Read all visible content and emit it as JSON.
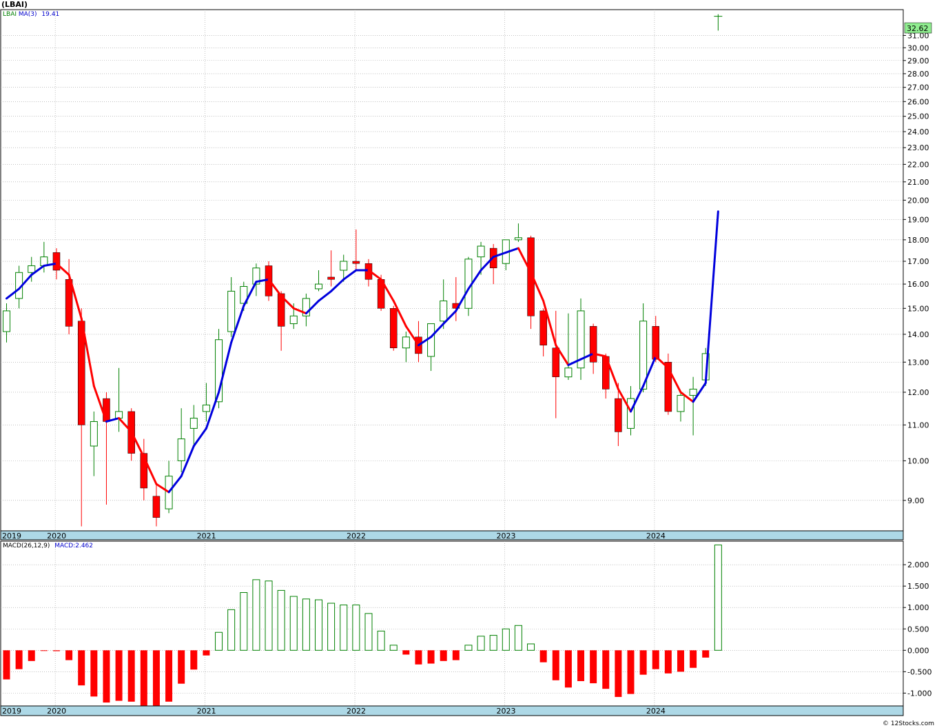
{
  "title": "(LBAI)",
  "legend": {
    "ticker": "LBAI",
    "ma_label": "MA(3)",
    "ma_value": "19.41",
    "macd_label": "MACD(26,12,9)",
    "macd_value": "MACD:2.462"
  },
  "last_price_badge": "32.62",
  "credit": "© 12Stocks.com",
  "colors": {
    "up": "#008000",
    "down": "#ff0000",
    "ma_up": "#0000dd",
    "ma_down": "#ff0000",
    "axis_band": "#add8e6",
    "grid": "#a9a9a9",
    "badge": "#90ee90"
  },
  "chart_data": [
    {
      "type": "candlestick",
      "title": "(LBAI)",
      "yscale": "log",
      "ylim": [
        8.3,
        33.2
      ],
      "y_ticks": [
        "9.00",
        "10.00",
        "11.00",
        "12.00",
        "13.00",
        "14.00",
        "15.00",
        "16.00",
        "17.00",
        "18.00",
        "19.00",
        "20.00",
        "21.00",
        "22.00",
        "23.00",
        "24.00",
        "25.00",
        "26.00",
        "27.00",
        "28.00",
        "29.00",
        "30.00",
        "31.00"
      ],
      "x_ticks": [
        "2019",
        "2020",
        "2021",
        "2022",
        "2023",
        "2024"
      ],
      "grid": true,
      "legend_position": "top-left",
      "candles": [
        {
          "o": 14.1,
          "h": 15.2,
          "l": 13.7,
          "c": 14.9
        },
        {
          "o": 15.4,
          "h": 16.8,
          "l": 15.0,
          "c": 16.5
        },
        {
          "o": 16.5,
          "h": 17.2,
          "l": 16.1,
          "c": 16.8
        },
        {
          "o": 16.8,
          "h": 17.9,
          "l": 16.5,
          "c": 17.2
        },
        {
          "o": 17.4,
          "h": 17.6,
          "l": 16.2,
          "c": 16.6
        },
        {
          "o": 16.2,
          "h": 17.1,
          "l": 14.0,
          "c": 14.3
        },
        {
          "o": 14.5,
          "h": 15.0,
          "l": 8.4,
          "c": 11.0
        },
        {
          "o": 10.4,
          "h": 11.4,
          "l": 9.6,
          "c": 11.1
        },
        {
          "o": 11.8,
          "h": 12.0,
          "l": 8.9,
          "c": 11.1
        },
        {
          "o": 11.2,
          "h": 12.8,
          "l": 10.8,
          "c": 11.4
        },
        {
          "o": 11.4,
          "h": 11.5,
          "l": 10.0,
          "c": 10.2
        },
        {
          "o": 10.2,
          "h": 10.6,
          "l": 9.0,
          "c": 9.3
        },
        {
          "o": 9.1,
          "h": 9.4,
          "l": 8.4,
          "c": 8.6
        },
        {
          "o": 8.8,
          "h": 10.0,
          "l": 8.7,
          "c": 9.6
        },
        {
          "o": 10.0,
          "h": 11.5,
          "l": 9.7,
          "c": 10.6
        },
        {
          "o": 10.9,
          "h": 11.6,
          "l": 10.4,
          "c": 11.2
        },
        {
          "o": 11.4,
          "h": 12.3,
          "l": 11.1,
          "c": 11.6
        },
        {
          "o": 11.7,
          "h": 14.2,
          "l": 11.5,
          "c": 13.8
        },
        {
          "o": 14.1,
          "h": 16.3,
          "l": 13.9,
          "c": 15.7
        },
        {
          "o": 15.2,
          "h": 16.1,
          "l": 14.9,
          "c": 15.9
        },
        {
          "o": 16.0,
          "h": 16.9,
          "l": 15.5,
          "c": 16.7
        },
        {
          "o": 16.8,
          "h": 17.0,
          "l": 15.3,
          "c": 15.5
        },
        {
          "o": 15.6,
          "h": 15.7,
          "l": 13.4,
          "c": 14.3
        },
        {
          "o": 14.4,
          "h": 15.2,
          "l": 14.2,
          "c": 14.7
        },
        {
          "o": 14.7,
          "h": 15.6,
          "l": 14.3,
          "c": 15.4
        },
        {
          "o": 15.8,
          "h": 16.6,
          "l": 15.7,
          "c": 16.0
        },
        {
          "o": 16.3,
          "h": 17.5,
          "l": 15.9,
          "c": 16.2
        },
        {
          "o": 16.6,
          "h": 17.3,
          "l": 16.1,
          "c": 17.0
        },
        {
          "o": 17.0,
          "h": 18.5,
          "l": 16.6,
          "c": 16.9
        },
        {
          "o": 16.9,
          "h": 17.1,
          "l": 15.9,
          "c": 16.2
        },
        {
          "o": 16.2,
          "h": 16.4,
          "l": 14.9,
          "c": 15.0
        },
        {
          "o": 15.0,
          "h": 15.1,
          "l": 13.4,
          "c": 13.5
        },
        {
          "o": 13.5,
          "h": 14.1,
          "l": 13.0,
          "c": 13.9
        },
        {
          "o": 13.9,
          "h": 14.5,
          "l": 13.0,
          "c": 13.3
        },
        {
          "o": 13.2,
          "h": 14.3,
          "l": 12.7,
          "c": 14.4
        },
        {
          "o": 14.5,
          "h": 16.2,
          "l": 14.2,
          "c": 15.3
        },
        {
          "o": 15.2,
          "h": 16.3,
          "l": 14.5,
          "c": 15.0
        },
        {
          "o": 15.0,
          "h": 17.2,
          "l": 14.7,
          "c": 17.1
        },
        {
          "o": 17.2,
          "h": 17.9,
          "l": 16.4,
          "c": 17.7
        },
        {
          "o": 17.6,
          "h": 17.8,
          "l": 16.0,
          "c": 16.7
        },
        {
          "o": 16.9,
          "h": 18.0,
          "l": 16.6,
          "c": 18.0
        },
        {
          "o": 18.0,
          "h": 18.8,
          "l": 17.9,
          "c": 18.1
        },
        {
          "o": 18.1,
          "h": 18.2,
          "l": 14.2,
          "c": 14.7
        },
        {
          "o": 14.9,
          "h": 15.0,
          "l": 13.2,
          "c": 13.6
        },
        {
          "o": 13.5,
          "h": 14.9,
          "l": 11.2,
          "c": 12.5
        },
        {
          "o": 12.5,
          "h": 14.8,
          "l": 12.4,
          "c": 12.8
        },
        {
          "o": 12.8,
          "h": 15.4,
          "l": 12.4,
          "c": 14.9
        },
        {
          "o": 14.3,
          "h": 14.4,
          "l": 12.6,
          "c": 13.0
        },
        {
          "o": 13.2,
          "h": 13.3,
          "l": 11.8,
          "c": 12.1
        },
        {
          "o": 11.8,
          "h": 12.3,
          "l": 10.4,
          "c": 10.8
        },
        {
          "o": 10.9,
          "h": 12.2,
          "l": 10.7,
          "c": 11.8
        },
        {
          "o": 12.1,
          "h": 15.2,
          "l": 12.0,
          "c": 14.5
        },
        {
          "o": 14.3,
          "h": 14.7,
          "l": 13.0,
          "c": 13.1
        },
        {
          "o": 13.0,
          "h": 13.3,
          "l": 11.3,
          "c": 11.4
        },
        {
          "o": 11.4,
          "h": 12.0,
          "l": 11.1,
          "c": 11.9
        },
        {
          "o": 11.9,
          "h": 12.5,
          "l": 10.7,
          "c": 12.1
        },
        {
          "o": 12.4,
          "h": 13.5,
          "l": 12.2,
          "c": 13.3
        },
        {
          "o": 31.6,
          "h": 32.8,
          "l": 31.4,
          "c": 32.62
        }
      ],
      "ma3": [
        15.4,
        15.8,
        16.4,
        16.8,
        16.9,
        16.4,
        14.6,
        12.2,
        11.1,
        11.2,
        10.8,
        10.1,
        9.4,
        9.2,
        9.6,
        10.4,
        10.9,
        12.0,
        13.7,
        15.1,
        16.1,
        16.2,
        15.5,
        15.0,
        14.8,
        15.3,
        15.7,
        16.2,
        16.6,
        16.6,
        16.2,
        15.3,
        14.3,
        13.6,
        13.9,
        14.4,
        14.9,
        15.8,
        16.6,
        17.2,
        17.4,
        17.6,
        16.5,
        15.3,
        13.6,
        12.9,
        13.1,
        13.3,
        13.2,
        12.1,
        11.4,
        12.2,
        13.2,
        12.8,
        12.0,
        11.7,
        12.3,
        19.41
      ]
    },
    {
      "type": "bar",
      "title": "MACD(26,12,9)",
      "ylim": [
        -1.3,
        2.55
      ],
      "y_ticks": [
        "-1.000",
        "-0.500",
        "0.000",
        "0.500",
        "1.000",
        "1.500",
        "2.000"
      ],
      "x_ticks": [
        "2019",
        "2020",
        "2021",
        "2022",
        "2023",
        "2024"
      ],
      "grid": true,
      "values": [
        -0.68,
        -0.44,
        -0.25,
        -0.01,
        -0.02,
        -0.23,
        -0.82,
        -1.08,
        -1.22,
        -1.18,
        -1.2,
        -1.3,
        -1.33,
        -1.2,
        -0.78,
        -0.45,
        -0.12,
        0.42,
        0.95,
        1.35,
        1.65,
        1.62,
        1.4,
        1.26,
        1.2,
        1.18,
        1.1,
        1.06,
        1.06,
        0.86,
        0.45,
        0.12,
        -0.1,
        -0.33,
        -0.31,
        -0.25,
        -0.23,
        0.12,
        0.33,
        0.35,
        0.5,
        0.58,
        0.15,
        -0.28,
        -0.7,
        -0.87,
        -0.72,
        -0.77,
        -0.9,
        -1.09,
        -1.02,
        -0.57,
        -0.44,
        -0.54,
        -0.5,
        -0.41,
        -0.17,
        2.462
      ]
    }
  ]
}
